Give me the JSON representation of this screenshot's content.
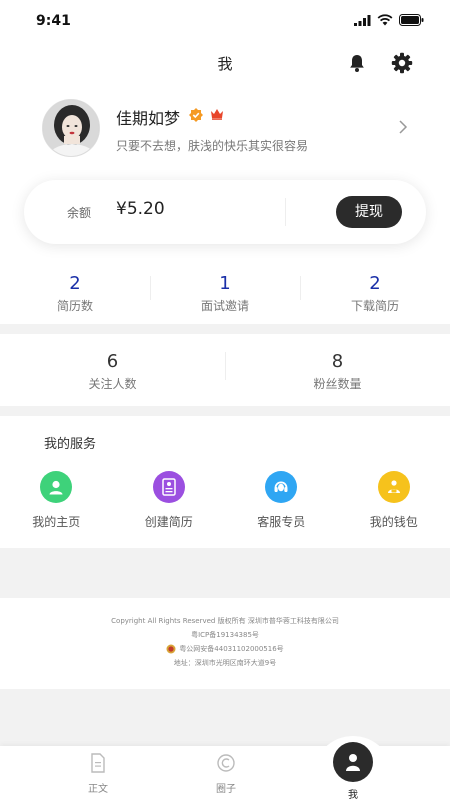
{
  "status_bar": {
    "time": "9:41"
  },
  "header": {
    "title": "我"
  },
  "profile": {
    "nickname": "佳期如梦",
    "signature": "只要不去想，肤浅的快乐其实很容易"
  },
  "wallet": {
    "balance_label": "余额",
    "balance_value": "¥5.20",
    "withdraw_label": "提现"
  },
  "stats_primary": [
    {
      "value": "2",
      "label": "简历数"
    },
    {
      "value": "1",
      "label": "面试邀请"
    },
    {
      "value": "2",
      "label": "下载简历"
    }
  ],
  "stats_secondary": [
    {
      "value": "6",
      "label": "关注人数"
    },
    {
      "value": "8",
      "label": "粉丝数量"
    }
  ],
  "services": {
    "title": "我的服务",
    "items": [
      {
        "label": "我的主页",
        "icon": "user-icon",
        "color": "#3ed27a"
      },
      {
        "label": "创建简历",
        "icon": "resume-icon",
        "color": "#9b4fe0"
      },
      {
        "label": "客服专员",
        "icon": "headset-icon",
        "color": "#2fa6f3"
      },
      {
        "label": "我的钱包",
        "icon": "wallet-icon",
        "color": "#f6c21c"
      }
    ]
  },
  "footer": {
    "line1": "Copyright All Rights Reserved 版权所有 深圳市普华蓉工科技有限公司",
    "line2": "粤ICP备19134385号",
    "line3": "粤公网安备44031102000516号",
    "line4": "地址：深圳市光明区南环大道9号"
  },
  "tabbar": {
    "items": [
      {
        "label": "正文",
        "icon": "document-icon"
      },
      {
        "label": "圈子",
        "icon": "circle-icon"
      },
      {
        "label": "我",
        "icon": "person-icon"
      }
    ]
  },
  "colors": {
    "stat_primary": "#1a2fa8",
    "dark_button": "#2b2b2b",
    "verified_badge": "#f59a23",
    "crown": "#e8462b"
  }
}
